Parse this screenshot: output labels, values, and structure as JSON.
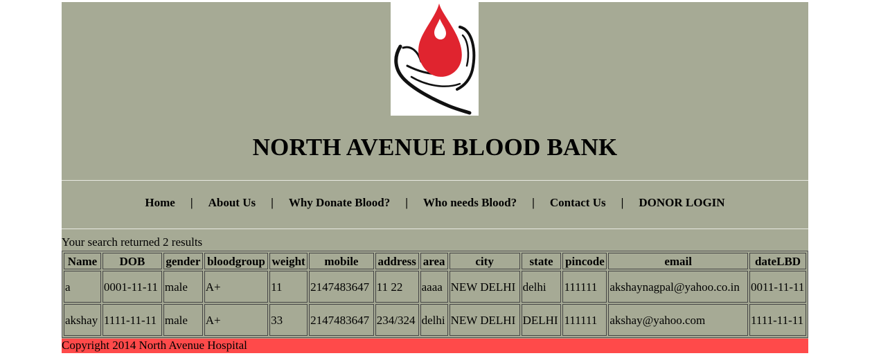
{
  "header": {
    "logo_icon": "blood-drop-hand-icon",
    "title": "NORTH AVENUE BLOOD BANK"
  },
  "nav": {
    "items": [
      {
        "label": "Home"
      },
      {
        "label": "About Us"
      },
      {
        "label": "Why Donate Blood?"
      },
      {
        "label": "Who needs Blood?"
      },
      {
        "label": "Contact Us"
      },
      {
        "label": "DONOR LOGIN"
      }
    ],
    "separator": "|"
  },
  "search": {
    "result_text": "Your search returned 2 results"
  },
  "table": {
    "columns": [
      "Name",
      "DOB",
      "gender",
      "bloodgroup",
      "weight",
      "mobile",
      "address",
      "area",
      "city",
      "state",
      "pincode",
      "email",
      "dateLBD"
    ],
    "rows": [
      [
        "a",
        "0001-11-11",
        "male",
        "A+",
        "11",
        "2147483647",
        "11 22",
        "aaaa",
        "NEW DELHI",
        "delhi",
        "111111",
        "akshaynagpal@yahoo.co.in",
        "0011-11-11"
      ],
      [
        "akshay",
        "1111-11-11",
        "male",
        "A+",
        "33",
        "2147483647",
        "234/324",
        "delhi",
        "NEW DELHI",
        "DELHI",
        "111111",
        "akshay@yahoo.com",
        "1111-11-11"
      ]
    ]
  },
  "footer": {
    "text": "Copyright 2014 North Avenue Hospital"
  },
  "colors": {
    "page_background": "#a6aa95",
    "footer_background": "#ff4a4a",
    "logo_drop": "#e0242f"
  }
}
